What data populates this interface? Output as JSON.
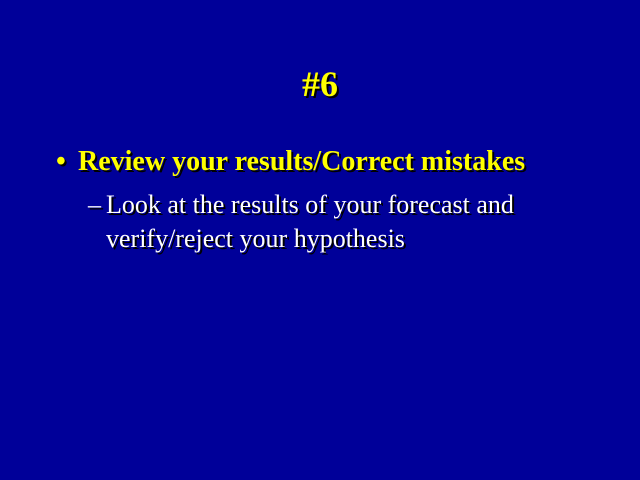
{
  "slide": {
    "title": "#6",
    "bullet": {
      "marker": "•",
      "text": "Review your results/Correct mistakes"
    },
    "sub_bullet": {
      "marker": "–",
      "text": "Look at the results of your forecast and verify/reject your hypothesis"
    },
    "colors": {
      "background": "#000099",
      "title": "#ffff00",
      "bullet": "#ffff00",
      "sub_bullet": "#ffffff"
    }
  }
}
